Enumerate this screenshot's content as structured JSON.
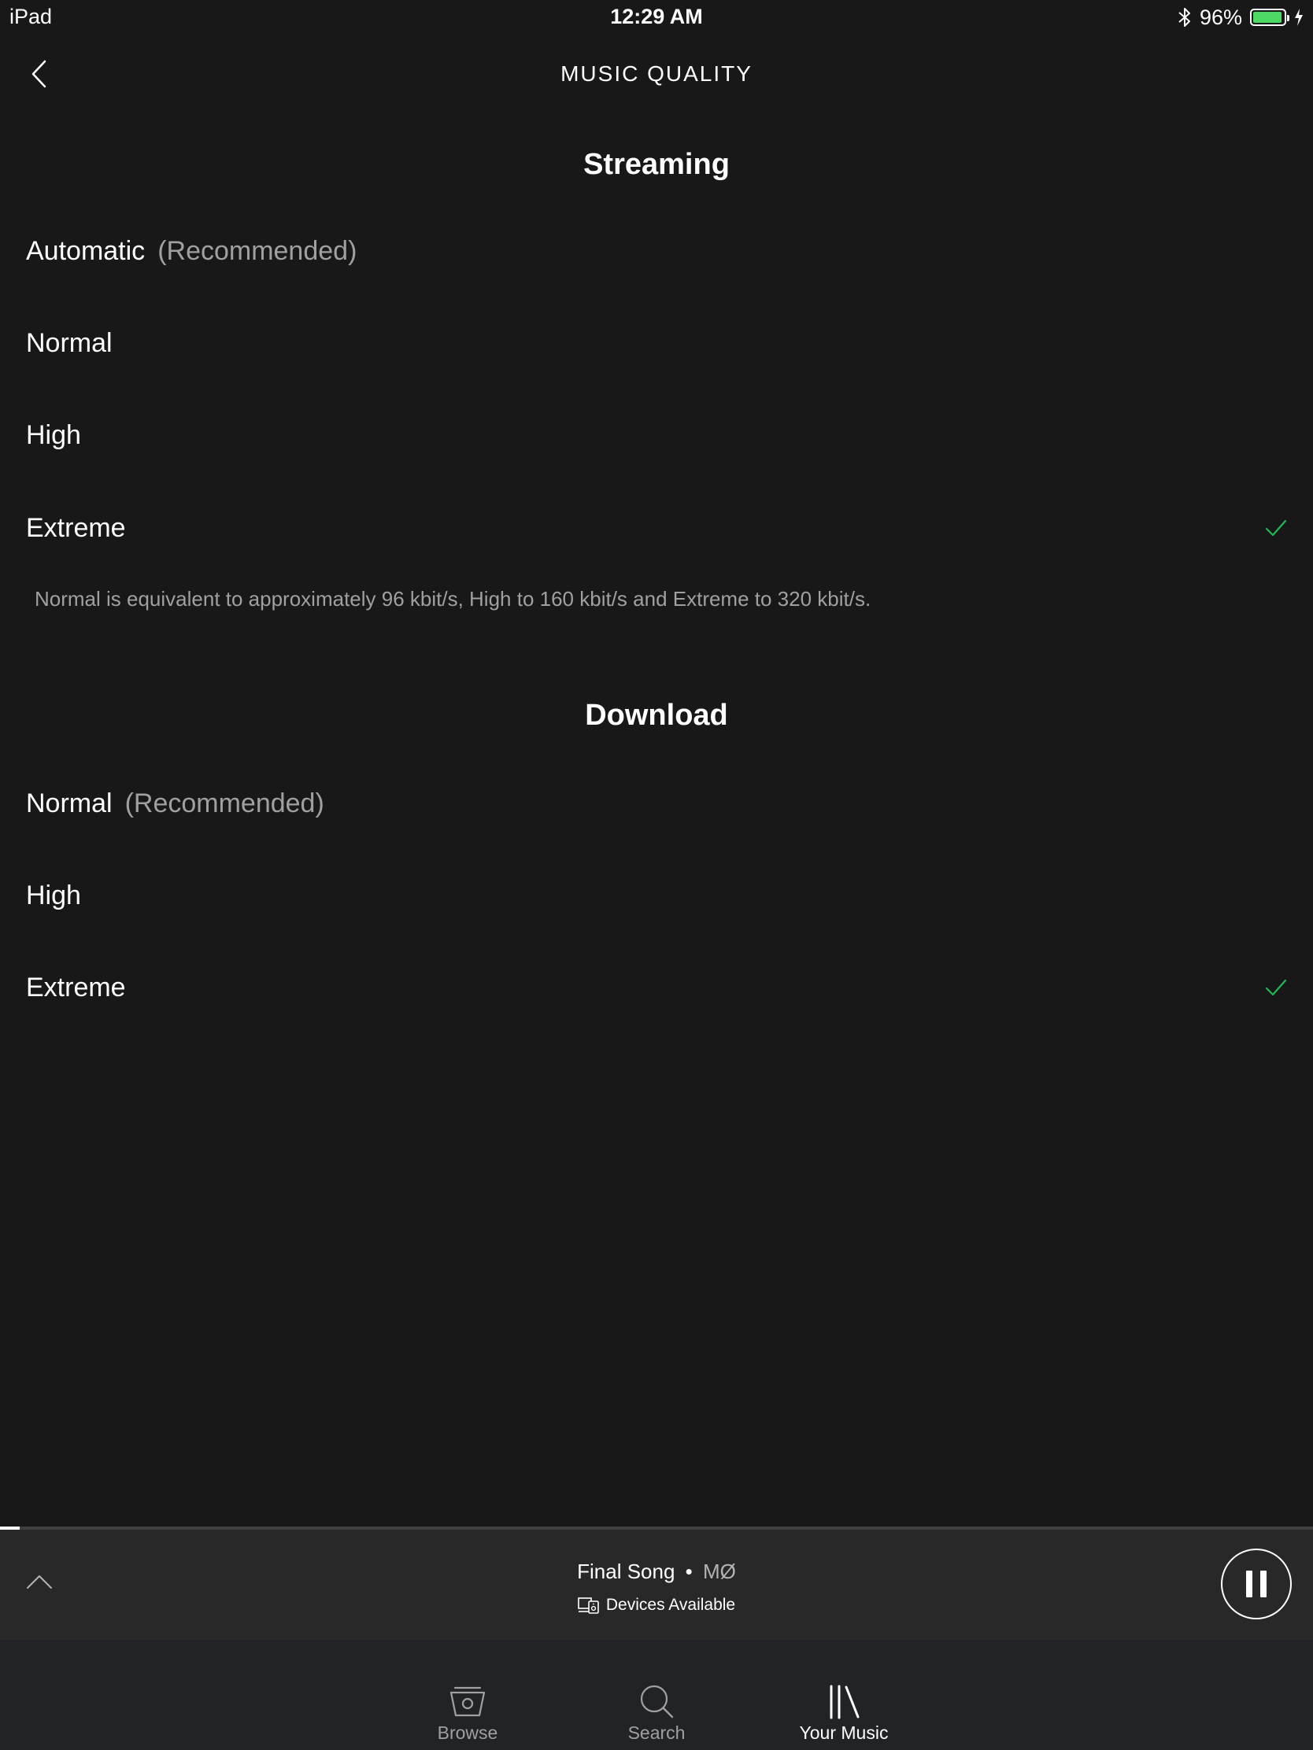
{
  "status_bar": {
    "device": "iPad",
    "time": "12:29 AM",
    "battery_percent": "96%",
    "battery_level": 0.96
  },
  "header": {
    "title": "MUSIC QUALITY",
    "back_icon": "chevron-left-icon"
  },
  "streaming": {
    "title": "Streaming",
    "options": [
      {
        "label": "Automatic",
        "note": "(Recommended)",
        "selected": false
      },
      {
        "label": "Normal",
        "note": "",
        "selected": false
      },
      {
        "label": "High",
        "note": "",
        "selected": false
      },
      {
        "label": "Extreme",
        "note": "",
        "selected": true
      }
    ],
    "info": "Normal is equivalent to approximately 96 kbit/s, High to 160 kbit/s and Extreme to 320 kbit/s."
  },
  "download": {
    "title": "Download",
    "options": [
      {
        "label": "Normal",
        "note": "(Recommended)",
        "selected": false
      },
      {
        "label": "High",
        "note": "",
        "selected": false
      },
      {
        "label": "Extreme",
        "note": "",
        "selected": true
      }
    ]
  },
  "now_playing": {
    "song": "Final Song",
    "separator": "•",
    "artist": "MØ",
    "devices_label": "Devices Available",
    "progress": 0.015,
    "accent_color": "#1db954"
  },
  "tabs": [
    {
      "label": "Browse",
      "icon": "browse-icon",
      "active": false
    },
    {
      "label": "Search",
      "icon": "search-icon",
      "active": false
    },
    {
      "label": "Your Music",
      "icon": "library-icon",
      "active": true
    }
  ]
}
